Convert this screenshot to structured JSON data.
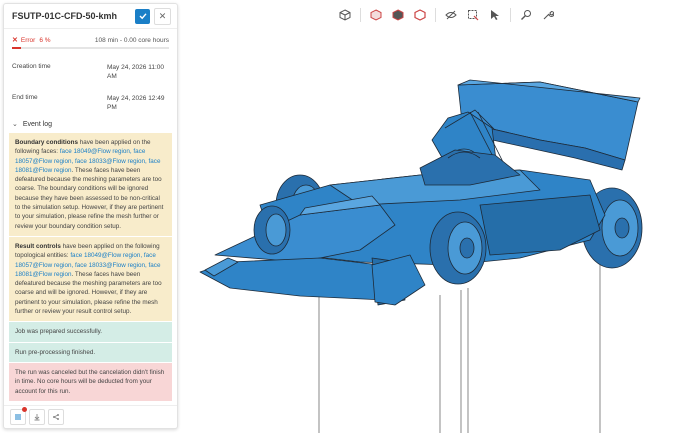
{
  "run": {
    "title": "FSUTP-01C-CFD-50-kmh",
    "status_label": "Error",
    "progress_text": "6 %",
    "progress_value": 0.06,
    "meta": "108 min - 0.00 core hours"
  },
  "info": {
    "creation_label": "Creation time",
    "creation_value": "May 24, 2026 11:00 AM",
    "end_label": "End time",
    "end_value": "May 24, 2026 12:49 PM"
  },
  "event_log": {
    "heading": "Event log",
    "boundary": {
      "lead": "Boundary conditions",
      "t1": " have been applied on the following faces: ",
      "faces": "face 18049@Flow region, face 18057@Flow region, face 18033@Flow region, face 18081@Flow region",
      "t2": ". These faces have been defeatured because the meshing parameters are too coarse. The boundary conditions will be ignored because they have been assessed to be non-critical to the simulation setup. However, if they are pertinent to your simulation, please refine the mesh further or review your boundary condition setup."
    },
    "result": {
      "lead": "Result controls",
      "t1": " have been applied on the following topological entities: ",
      "faces": "face 18049@Flow region, face 18057@Flow region, face 18033@Flow region, face 18081@Flow region",
      "t2": ". These faces have been defeatured because the meshing parameters are too coarse and will be ignored. However, if they are pertinent to your simulation, please refine the mesh further or review your result control setup."
    },
    "ok1": "Job was prepared successfully.",
    "ok2": "Run pre-processing finished.",
    "error": "The run was canceled but the cancelation didn't finish in time. No core hours will be deducted from your account for this run."
  },
  "toolbar": {
    "icons": [
      "cube-view-icon",
      "box-select-icon",
      "hide-icon",
      "box-outline-icon",
      "visibility-icon",
      "rect-select-icon",
      "cursor-select-icon",
      "measure-icon",
      "settings-wrench-icon"
    ]
  },
  "footer": {
    "icons": [
      "event-list-icon",
      "download-icon",
      "share-icon"
    ]
  },
  "colors": {
    "accent": "#1a7fc7",
    "error": "#d9342b",
    "car": "#2f84c7"
  }
}
